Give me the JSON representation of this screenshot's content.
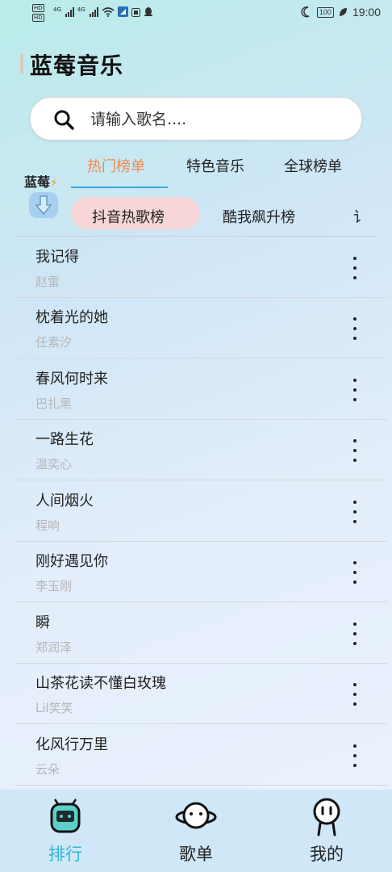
{
  "status_bar": {
    "hd_badge": "HD",
    "net_type_1": "4G",
    "net_type_2": "4G",
    "battery": "100",
    "time": "19:00"
  },
  "app": {
    "title": "蓝莓音乐"
  },
  "search": {
    "placeholder": "请输入歌名...."
  },
  "brand": {
    "label": "蓝莓"
  },
  "main_tabs": [
    {
      "label": "热门榜单",
      "active": true
    },
    {
      "label": "特色音乐",
      "active": false
    },
    {
      "label": "全球榜单",
      "active": false
    }
  ],
  "sub_tabs": [
    {
      "label": "抖音热歌榜",
      "active": true
    },
    {
      "label": "酷我飙升榜",
      "active": false
    },
    {
      "label": "讠",
      "active": false
    }
  ],
  "songs": [
    {
      "name": "我记得",
      "artist": "赵雷"
    },
    {
      "name": "枕着光的她",
      "artist": "任素汐"
    },
    {
      "name": "春风何时来",
      "artist": "巴扎黑"
    },
    {
      "name": "一路生花",
      "artist": "温奕心"
    },
    {
      "name": "人间烟火",
      "artist": "程响"
    },
    {
      "name": "刚好遇见你",
      "artist": "李玉刚"
    },
    {
      "name": "瞬",
      "artist": "郑润泽"
    },
    {
      "name": "山茶花读不懂白玫瑰",
      "artist": "Lil笑笑"
    },
    {
      "name": "化风行万里",
      "artist": "云朵"
    }
  ],
  "bottom_nav": [
    {
      "label": "排行",
      "icon": "robot-icon",
      "active": true
    },
    {
      "label": "歌单",
      "icon": "planet-icon",
      "active": false
    },
    {
      "label": "我的",
      "icon": "person-icon",
      "active": false
    }
  ],
  "colors": {
    "accent_orange": "#ef8a54",
    "accent_blue": "#3aa7e0",
    "active_nav": "#2eb6d6",
    "pill_pink": "#f6d6d6"
  }
}
